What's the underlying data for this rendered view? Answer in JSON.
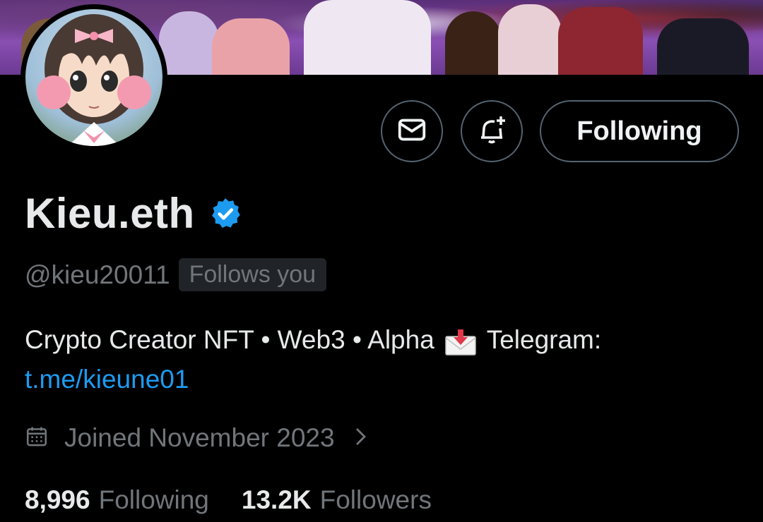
{
  "banner": {
    "icon": "group-photo"
  },
  "profile": {
    "display_name": "Kieu.eth",
    "verified_icon": "verified-badge-icon",
    "handle": "@kieu20011",
    "follows_you_label": "Follows you",
    "bio_text": "Crypto Creator NFT • Web3 • Alpha",
    "bio_emoji": "incoming-envelope-emoji",
    "bio_text_after": "Telegram:",
    "bio_link": "t.me/kieune01",
    "joined": "Joined November 2023"
  },
  "actions": {
    "message_icon": "envelope-icon",
    "notify_icon": "bell-plus-icon",
    "follow_label": "Following"
  },
  "stats": {
    "following_count": "8,996",
    "following_label": "Following",
    "followers_count": "13.2K",
    "followers_label": "Followers"
  },
  "colors": {
    "accent": "#1d9bf0",
    "muted": "#71767b",
    "background": "#000000"
  }
}
